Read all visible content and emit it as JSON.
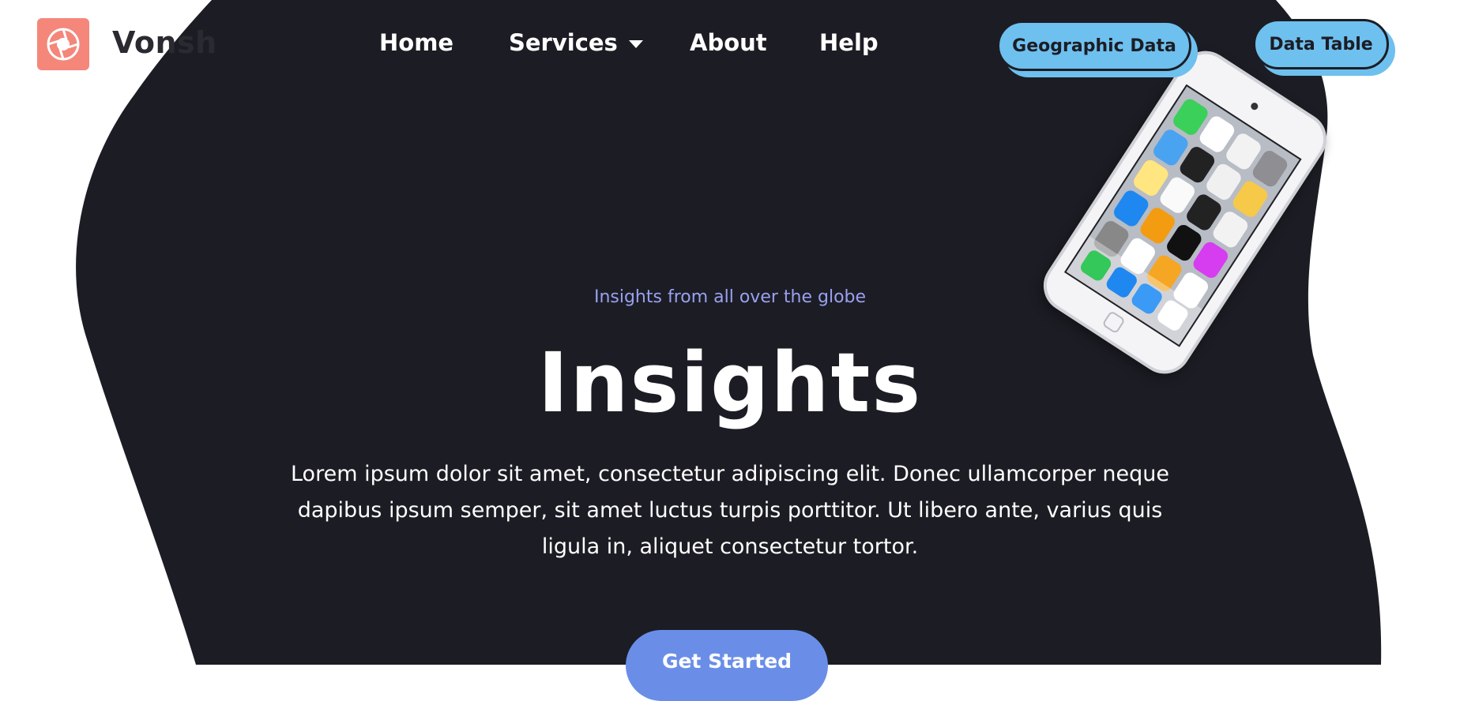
{
  "brand": {
    "name": "Vonsh"
  },
  "nav": {
    "items": [
      {
        "label": "Home"
      },
      {
        "label": "Services"
      },
      {
        "label": "About"
      },
      {
        "label": "Help"
      }
    ]
  },
  "actions": {
    "geographic": "Geographic Data",
    "table": "Data Table"
  },
  "hero": {
    "tagline": "Insights from all over the globe",
    "title": "Insights",
    "body": "Lorem ipsum dolor sit amet, consectetur adipiscing elit. Donec ullamcorper neque dapibus ipsum semper, sit amet luctus turpis porttitor. Ut libero ante, varius quis ligula in, aliquet consectetur tortor.",
    "cta": "Get Started"
  },
  "colors": {
    "background": "#ffffff",
    "hero_bg": "#1c1d24",
    "accent_blue": "#6ec0ef",
    "cta_blue": "#6a8ee8",
    "tagline": "#9aa0f0",
    "logo": "#f4877a"
  },
  "icons": {
    "logo": "aperture-icon",
    "dropdown": "chevron-down-icon",
    "device": "phone-image"
  }
}
